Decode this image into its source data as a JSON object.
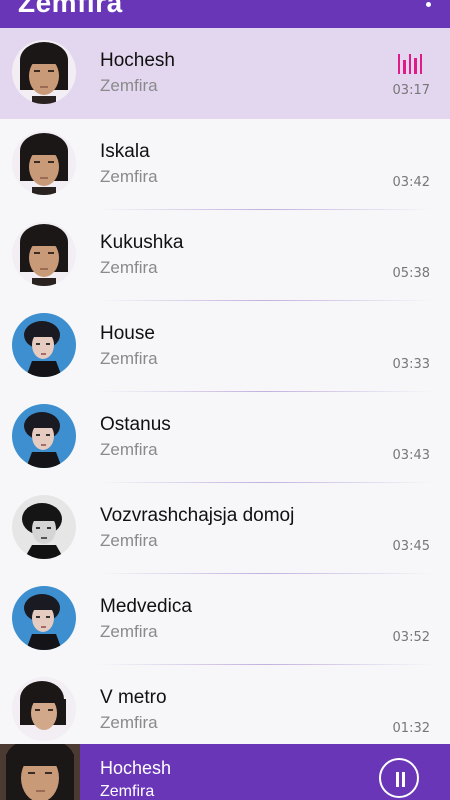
{
  "appbar": {
    "title": "Zemfira",
    "menu_icon": "more-vert-icon"
  },
  "tracks": [
    {
      "title": "Hochesh",
      "artist": "Zemfira",
      "duration": "03:17",
      "active": true,
      "avatar": "dark"
    },
    {
      "title": "Iskala",
      "artist": "Zemfira",
      "duration": "03:42",
      "avatar": "dark"
    },
    {
      "title": "Kukushka",
      "artist": "Zemfira",
      "duration": "05:38",
      "avatar": "dark"
    },
    {
      "title": "House",
      "artist": "Zemfira",
      "duration": "03:33",
      "avatar": "blue"
    },
    {
      "title": "Ostanus",
      "artist": "Zemfira",
      "duration": "03:43",
      "avatar": "blue"
    },
    {
      "title": "Vozvrashchajsja domoj",
      "artist": "Zemfira",
      "duration": "03:45",
      "avatar": "bw"
    },
    {
      "title": "Medvedica",
      "artist": "Zemfira",
      "duration": "03:52",
      "avatar": "blue"
    },
    {
      "title": "V metro",
      "artist": "Zemfira",
      "duration": "01:32",
      "avatar": "dark"
    }
  ],
  "now_playing": {
    "title": "Hochesh",
    "artist": "Zemfira",
    "button_icon": "pause-icon",
    "indicator_icon": "equalizer-icon"
  },
  "colors": {
    "accent": "#6a36b8",
    "active_row": "#e3d7ef",
    "equalizer": "#e01a86"
  }
}
